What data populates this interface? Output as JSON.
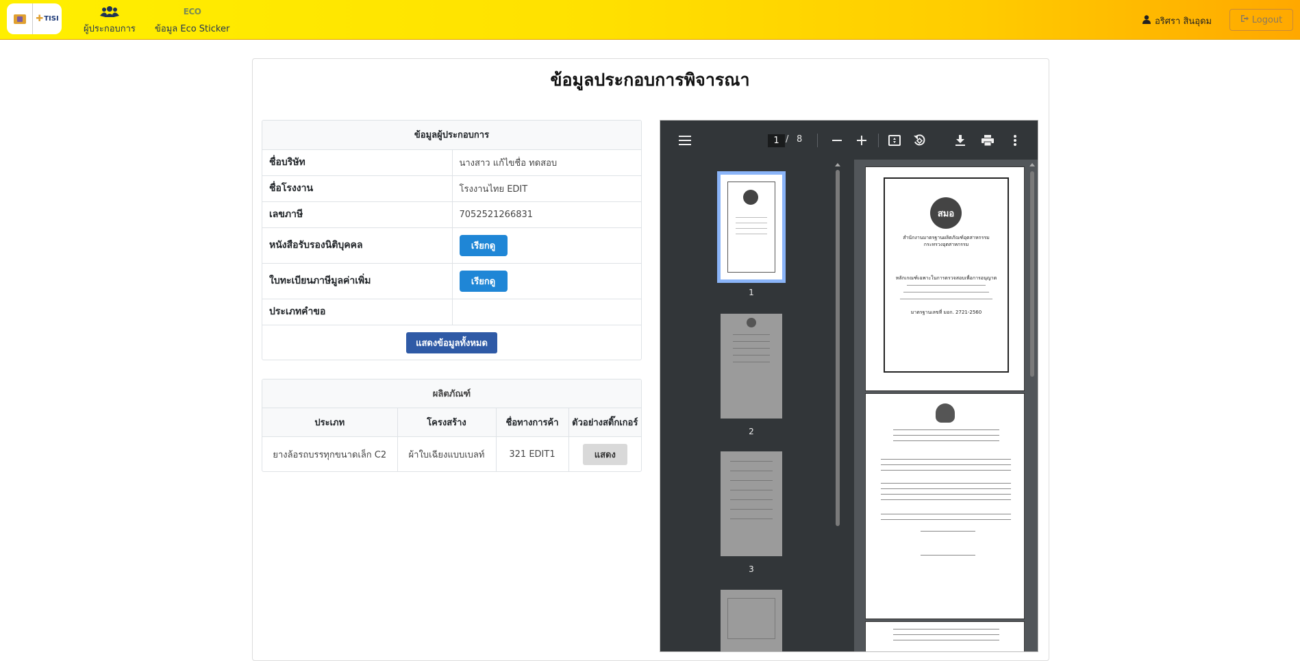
{
  "nav": {
    "logo_text": "TISI",
    "operators_label": "ผู้ประกอบการ",
    "eco_label": "ข้อมูล Eco Sticker",
    "eco_logo": "ECO",
    "user_name": "อริศรา สินอุดม",
    "logout_label": "Logout",
    "icons": [
      "users-icon",
      "eco-icon",
      "user-icon",
      "logout-icon"
    ]
  },
  "page": {
    "title": "ข้อมูลประกอบการพิจารณา"
  },
  "operator": {
    "header": "ข้อมูลผู้ประกอบการ",
    "rows": [
      {
        "label": "ชื่อบริษัท",
        "value": "นางสาว แก้ไขชื่อ ทดสอบ"
      },
      {
        "label": "ชื่อโรงงาน",
        "value": "โรงงานไทย EDIT"
      },
      {
        "label": "เลขภาษี",
        "value": "7052521266831"
      },
      {
        "label": "หนังสือรับรองนิติบุคคล",
        "button": "เรียกดู"
      },
      {
        "label": "ใบทะเบียนภาษีมูลค่าเพิ่ม",
        "button": "เรียกดู"
      },
      {
        "label": "ประเภทคำขอ",
        "value": ""
      }
    ],
    "show_all_label": "แสดงข้อมูลทั้งหมด"
  },
  "products": {
    "header": "ผลิตภัณฑ์",
    "columns": [
      "ประเภท",
      "โครงสร้าง",
      "ชื่อทางการค้า",
      "ตัวอย่างสติ๊กเกอร์"
    ],
    "rows": [
      {
        "type": "ยางล้อรถบรรทุกขนาดเล็ก C2",
        "structure": "ผ้าใบเฉียงแบบเบลท์",
        "trade_name": "321 EDIT1",
        "action": "แสดง"
      }
    ]
  },
  "pdf": {
    "current_page": "1",
    "separator": "/",
    "total_pages": "8",
    "thumbnail_numbers": [
      "1",
      "2",
      "3"
    ],
    "seal_text": "สมอ",
    "page1_org": "สำนักงานมาตรฐานผลิตภัณฑ์อุตสาหกรรม",
    "page1_ministry": "กระทรวงอุตสาหกรรม",
    "page1_heading": "หลักเกณฑ์เฉพาะในการตรวจสอบเพื่อการอนุญาต",
    "page1_std": "มาตรฐานเลขที่ มอก. 2721-2560",
    "icons": [
      "menu-icon",
      "zoom-out-icon",
      "zoom-in-icon",
      "fit-page-icon",
      "rotate-icon",
      "download-icon",
      "print-icon",
      "more-icon"
    ]
  }
}
